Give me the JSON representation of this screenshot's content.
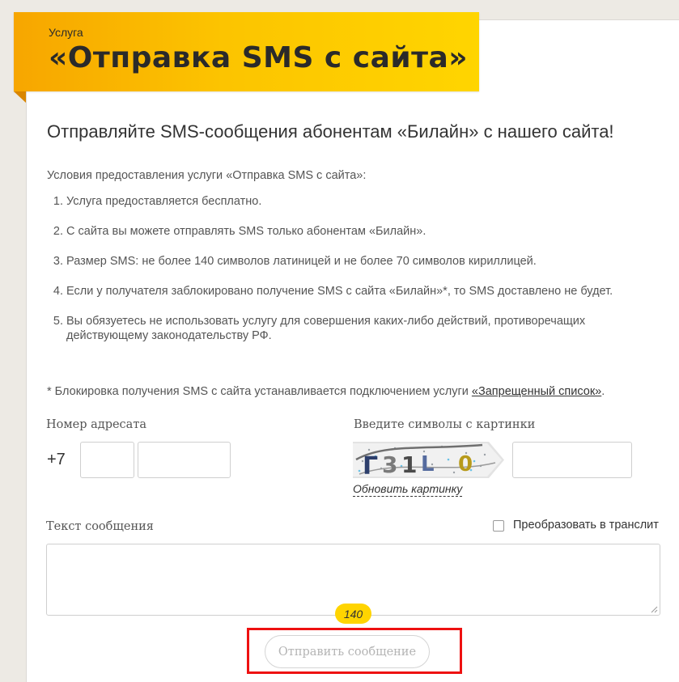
{
  "banner": {
    "subtitle": "Услуга",
    "title": "«Отправка SMS с сайта»"
  },
  "headline": "Отправляйте SMS-сообщения абонентам «Билайн» с нашего сайта!",
  "conditions": {
    "title": "Условия предоставления услуги «Отправка SMS с сайта»:",
    "items": [
      "Услуга предоставляется бесплатно.",
      "С сайта вы можете отправлять SMS только абонентам «Билайн».",
      "Размер SMS: не более 140 символов латиницей и не более 70 символов кириллицей.",
      "Если у получателя заблокировано получение SMS с сайта «Билайн»*, то SMS доставлено не будет.",
      "Вы обязуетесь не использовать услугу для совершения каких-либо действий, противоречащих действующему законодательству РФ."
    ]
  },
  "note": {
    "text": "*  Блокировка получения SMS с сайта  устанавливается подключением услуги ",
    "link": "«Запрещенный список»",
    "end": "."
  },
  "form": {
    "recipient_label": "Номер адресата",
    "phone_prefix": "+7",
    "phone_code_value": "",
    "phone_number_value": "",
    "captcha_label": "Введите символы с картинки",
    "captcha_value": "",
    "refresh_link": "Обновить картинку",
    "message_label": "Текст сообщения",
    "translit_label": "Преобразовать в транслит",
    "translit_checked": false,
    "message_value": "",
    "counter": "140",
    "submit_label": "Отправить сообщение"
  },
  "colors": {
    "brand_yellow": "#ffd400",
    "banner_orange": "#f7a600",
    "highlight_red": "#ee1111"
  }
}
